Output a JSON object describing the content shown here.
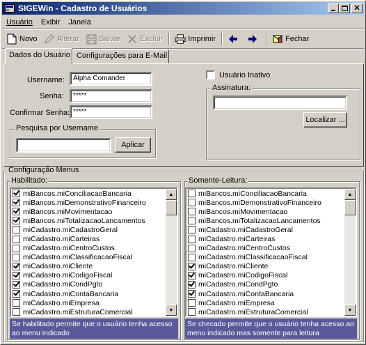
{
  "window": {
    "title": "SIGEWin - Cadastro de Usuários"
  },
  "menu": [
    "Usuário",
    "Exibir",
    "Janela"
  ],
  "toolbar": {
    "novo": "Novo",
    "alterar": "Alterar",
    "salvar": "Salvar",
    "excluir": "Excluir",
    "imprimir": "Imprimir",
    "fechar": "Fechar"
  },
  "tabs": [
    "Dados do Usuário",
    "Configurações para E-Mail"
  ],
  "form": {
    "username_label": "Username:",
    "username_value": "Alpha Comander",
    "senha_label": "Senha:",
    "senha_value": "*****",
    "confirmar_label": "Confirmar Senha:",
    "confirmar_value": "*****",
    "pesquisa_group": "Pesquisa por Username",
    "pesquisa_value": "",
    "aplicar_button": "Aplicar",
    "inativo_label": "Usuário Inativo",
    "inativo_checked": false,
    "assinatura_group": "Assinatura:",
    "assinatura_value": "",
    "localizar_button": "Localizar ..."
  },
  "config": {
    "title": "Configuração Menus",
    "habilitado_title": "Habilitado:",
    "somente_title": "Somente-Leitura:",
    "habilitado_hint": "Se habilitado permite que o usuário tenha acesso ao menu indicado",
    "somente_hint": "Se checado permite que o usuário tenha acesso ao menu indicado mas somente para leitura",
    "habilitado_items": [
      {
        "label": "miBancos.miConciliacaoBancaria",
        "checked": true
      },
      {
        "label": "miBancos.miDemonstrativoFinanceiro",
        "checked": true
      },
      {
        "label": "miBancos.miMovimentacao",
        "checked": true
      },
      {
        "label": "miBancos.miTotalizacaoLancamentos",
        "checked": true
      },
      {
        "label": "miCadastro.miCadastroGeral",
        "checked": false
      },
      {
        "label": "miCadastro.miCarteiras",
        "checked": false
      },
      {
        "label": "miCadastro.miCentroCustos",
        "checked": false
      },
      {
        "label": "miCadastro.miClassificacaoFiscal",
        "checked": false
      },
      {
        "label": "miCadastro.miCliente",
        "checked": true
      },
      {
        "label": "miCadastro.miCodigoFiscal",
        "checked": true
      },
      {
        "label": "miCadastro.miCondPgto",
        "checked": true
      },
      {
        "label": "miCadastro.miContaBancaria",
        "checked": true
      },
      {
        "label": "miCadastro.miEmpresa",
        "checked": false
      },
      {
        "label": "miCadastro.miEstruturaComercial",
        "checked": false
      }
    ],
    "somente_items": [
      {
        "label": "miBancos.miConciliacaoBancaria",
        "checked": false
      },
      {
        "label": "miBancos.miDemonstrativoFinanceiro",
        "checked": false
      },
      {
        "label": "miBancos.miMovimentacao",
        "checked": false
      },
      {
        "label": "miBancos.miTotalizacaoLancamentos",
        "checked": false
      },
      {
        "label": "miCadastro.miCadastroGeral",
        "checked": false
      },
      {
        "label": "miCadastro.miCarteiras",
        "checked": false
      },
      {
        "label": "miCadastro.miCentroCustos",
        "checked": false
      },
      {
        "label": "miCadastro.miClassificacaoFiscal",
        "checked": false
      },
      {
        "label": "miCadastro.miCliente",
        "checked": true
      },
      {
        "label": "miCadastro.miCodigoFiscal",
        "checked": true
      },
      {
        "label": "miCadastro.miCondPgto",
        "checked": true
      },
      {
        "label": "miCadastro.miContaBancaria",
        "checked": true
      },
      {
        "label": "miCadastro.miEmpresa",
        "checked": false
      },
      {
        "label": "miCadastro.miEstruturaComercial",
        "checked": false
      }
    ]
  },
  "icons": {
    "app": "app-icon",
    "novo": "new-document-icon",
    "alterar": "edit-icon",
    "salvar": "save-disk-icon",
    "excluir": "delete-icon",
    "imprimir": "printer-icon",
    "prev": "arrow-left-icon",
    "next": "arrow-right-icon",
    "fechar": "close-door-icon"
  },
  "colors": {
    "titlebar_start": "#0a246a",
    "titlebar_end": "#a6caf0",
    "hint_bg": "#5a5a9a",
    "face": "#d4d0c8"
  }
}
